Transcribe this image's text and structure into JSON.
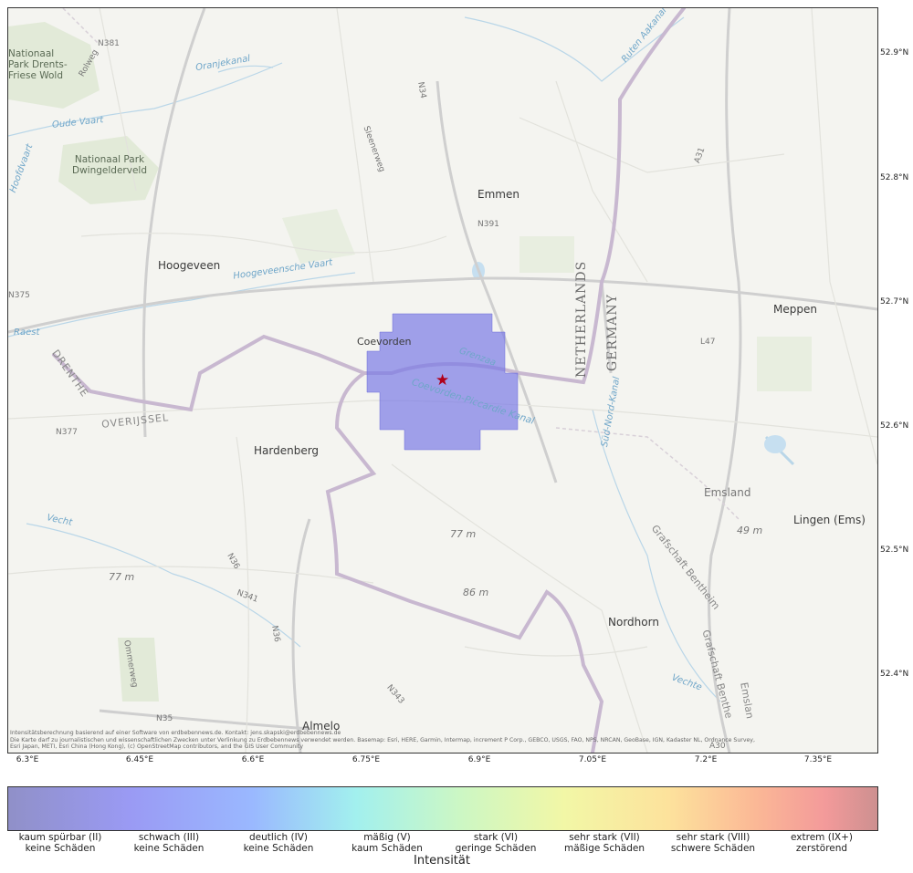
{
  "map": {
    "places": {
      "nationaal_park_drents": "Nationaal Park Drents-Friese Wold",
      "nationaal_park_dwingelderveld": "Nationaal Park Dwingelderveld",
      "emmen": "Emmen",
      "hoogeveen": "Hoogeveen",
      "coevorden": "Coevorden",
      "hardenberg": "Hardenberg",
      "meppen": "Meppen",
      "lingen": "Lingen (Ems)",
      "nordhorn": "Nordhorn",
      "almelo": "Almelo",
      "emsland": "Emsland",
      "grafschaft_bentheim": "Grafschaft Bentheim",
      "grafschaft_benthe": "Grafschaft Benthe",
      "emslan": "Emslan"
    },
    "regions": {
      "drenthe": "DRENTHE",
      "overijssel": "OVERIJSSEL",
      "netherlands": "NETHERLANDS",
      "germany": "GERMANY"
    },
    "water": {
      "oranjekanal": "Oranjekanal",
      "oude_vaart": "Oude Vaart",
      "hoofdvaart": "Hoofdvaart",
      "hoogeveensche_vaart": "Hoogeveensche Vaart",
      "grenzaa": "Grenzaa",
      "coevorden_piccardie": "Coevorden-Piccardie Kanal",
      "sud_nord_kanal": "Süd-Nord-Kanal",
      "vechte": "Vechte",
      "vecht": "Vecht",
      "ruten_aakanal": "Ruten Aakanal",
      "raest": "Raest"
    },
    "roads": {
      "n381": "N381",
      "n34": "N34",
      "n391": "N391",
      "n375": "N375",
      "n377": "N377",
      "n36": "N36",
      "n341": "N341",
      "n343": "N343",
      "n35": "N35",
      "a31": "A31",
      "a30": "A30",
      "l47": "L47",
      "n36b": "N36",
      "stienerweg": "Sleenerweg",
      "ommerweg": "Ommerweg",
      "rolweg": "Rolweg"
    },
    "elevations": [
      "77 m",
      "77 m",
      "86 m",
      "49 m"
    ],
    "attribution": [
      "Intensitätsberechnung basierend auf einer Software von erdbebennews.de. Kontakt: jens.skapski@erdbebennews.de",
      "Die Karte darf zu journalistischen und wissenschaftlichen Zwecken unter Verlinkung zu Erdbebennews verwendet werden. Basemap: Esri, HERE, Garmin, Intermap, increment P Corp., GEBCO, USGS, FAO, NPS, NRCAN, GeoBase, IGN, Kadaster NL, Ordnance Survey,",
      "Esri Japan, METI, Esri China (Hong Kong), (c) OpenStreetMap contributors, and the GIS User Community"
    ],
    "epicenter_symbol": "★",
    "intensity_color": "#7a7ae6"
  },
  "axes": {
    "lat_labels": [
      "52.9°N",
      "52.8°N",
      "52.7°N",
      "52.6°N",
      "52.5°N",
      "52.4°N"
    ],
    "lon_labels": [
      "6.3°E",
      "6.45°E",
      "6.6°E",
      "6.75°E",
      "6.9°E",
      "7.05°E",
      "7.2°E",
      "7.35°E"
    ]
  },
  "colorbar": {
    "title": "Intensität",
    "labels": [
      {
        "line1": "kaum spürbar (II)",
        "line2": "keine Schäden"
      },
      {
        "line1": "schwach (III)",
        "line2": "keine Schäden"
      },
      {
        "line1": "deutlich (IV)",
        "line2": "keine Schäden"
      },
      {
        "line1": "mäßig (V)",
        "line2": "kaum Schäden"
      },
      {
        "line1": "stark (VI)",
        "line2": "geringe Schäden"
      },
      {
        "line1": "sehr stark (VII)",
        "line2": "mäßige Schäden"
      },
      {
        "line1": "sehr stark (VIII)",
        "line2": "schwere Schäden"
      },
      {
        "line1": "extrem (IX+)",
        "line2": "zerstörend"
      }
    ]
  }
}
